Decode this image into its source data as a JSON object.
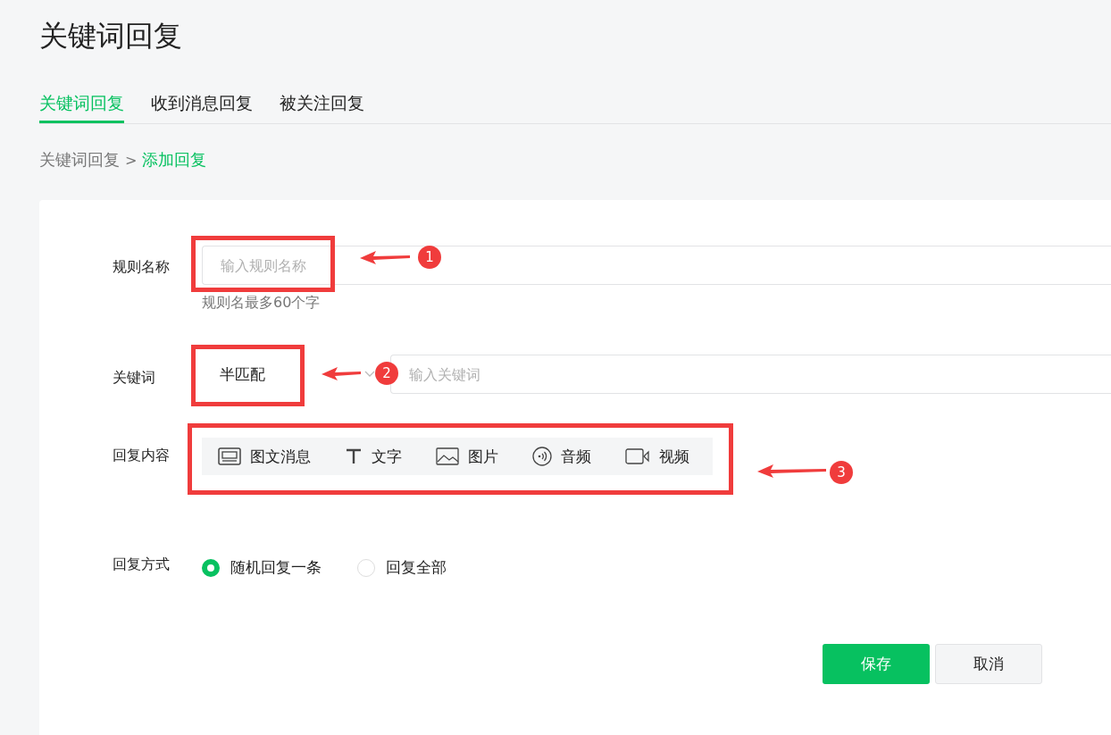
{
  "page_title": "关键词回复",
  "tabs": [
    {
      "label": "关键词回复",
      "selected": true
    },
    {
      "label": "收到消息回复",
      "selected": false
    },
    {
      "label": "被关注回复",
      "selected": false
    }
  ],
  "breadcrumb": {
    "parent": "关键词回复",
    "separator": ">",
    "current": "添加回复"
  },
  "form": {
    "rule_name": {
      "label": "规则名称",
      "placeholder": "输入规则名称",
      "hint": "规则名最多60个字"
    },
    "keyword": {
      "label": "关键词",
      "match_mode": "半匹配",
      "placeholder": "输入关键词"
    },
    "reply_content": {
      "label": "回复内容",
      "types": [
        {
          "kind": "news",
          "label": "图文消息"
        },
        {
          "kind": "text",
          "label": "文字"
        },
        {
          "kind": "image",
          "label": "图片"
        },
        {
          "kind": "audio",
          "label": "音频"
        },
        {
          "kind": "video",
          "label": "视频"
        }
      ]
    },
    "reply_mode": {
      "label": "回复方式",
      "options": [
        {
          "label": "随机回复一条",
          "selected": true
        },
        {
          "label": "回复全部",
          "selected": false
        }
      ]
    }
  },
  "buttons": [
    {
      "kind": "primary",
      "label": "保存"
    },
    {
      "kind": "secondary",
      "label": "取消"
    }
  ],
  "annotations": [
    {
      "number": "1"
    },
    {
      "number": "2"
    },
    {
      "number": "3"
    }
  ]
}
